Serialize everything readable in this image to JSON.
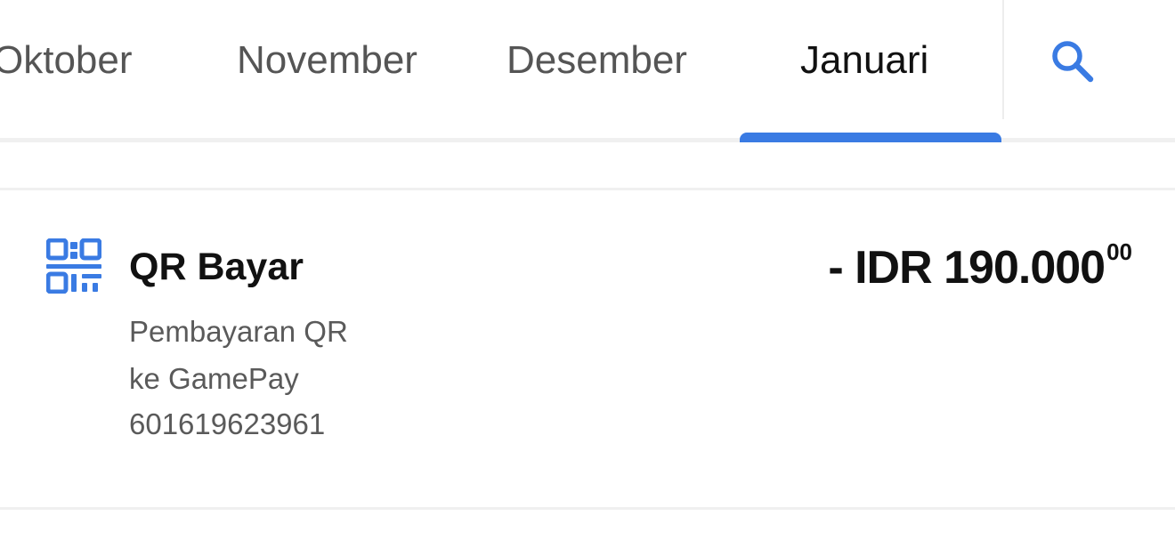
{
  "month_tabs": {
    "items": [
      {
        "label": "Oktober",
        "active": false
      },
      {
        "label": "November",
        "active": false
      },
      {
        "label": "Desember",
        "active": false
      },
      {
        "label": "Januari",
        "active": true
      }
    ],
    "search_icon": "search-icon"
  },
  "colors": {
    "accent": "#3a7be3",
    "text_primary": "#111111",
    "text_secondary": "#5a5a5a",
    "divider": "#f0f0f0"
  },
  "transactions": [
    {
      "icon": "qr-code-icon",
      "title": "QR Bayar",
      "description_lines": [
        "Pembayaran QR",
        "ke GamePay",
        "601619623961"
      ],
      "amount_main": "- IDR 190.000",
      "amount_cents": "00"
    }
  ]
}
